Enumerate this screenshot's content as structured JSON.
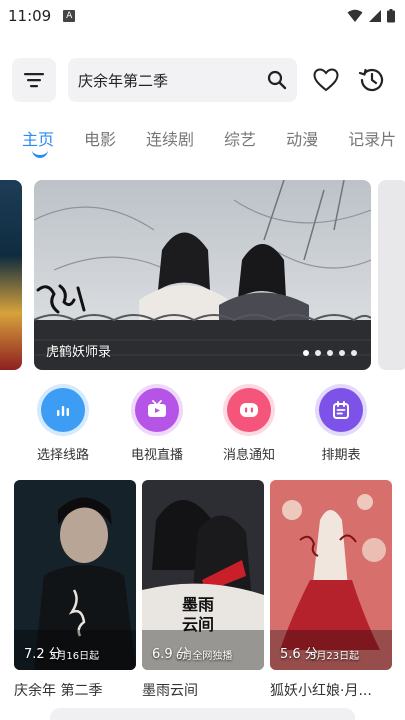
{
  "status": {
    "time": "11:09",
    "a_icon": "A"
  },
  "search": {
    "value": "庆余年第二季"
  },
  "tabs": [
    {
      "label": "主页",
      "active": true
    },
    {
      "label": "电影"
    },
    {
      "label": "连续剧"
    },
    {
      "label": "综艺"
    },
    {
      "label": "动漫"
    },
    {
      "label": "记录片"
    }
  ],
  "banner": {
    "title": "虎鹤妖师录",
    "dots": 5,
    "active_dot": 0
  },
  "actions": [
    {
      "label": "选择线路",
      "icon": "route-icon",
      "color": "#3d9df5"
    },
    {
      "label": "电视直播",
      "icon": "tv-icon",
      "color": "#b654e8"
    },
    {
      "label": "消息通知",
      "icon": "message-icon",
      "color": "#f5557a"
    },
    {
      "label": "排期表",
      "icon": "schedule-icon",
      "color": "#7d52e8"
    }
  ],
  "cards": [
    {
      "title": "庆余年 第二季",
      "score": "7.2 分",
      "date": "5月16日起"
    },
    {
      "title": "墨雨云间",
      "score": "6.9 分",
      "date": "6月全网独播"
    },
    {
      "title": "狐妖小红娘·月...",
      "score": "5.6 分",
      "date": "5月23日起"
    }
  ],
  "colors": {
    "accent": "#2a8bf2"
  }
}
